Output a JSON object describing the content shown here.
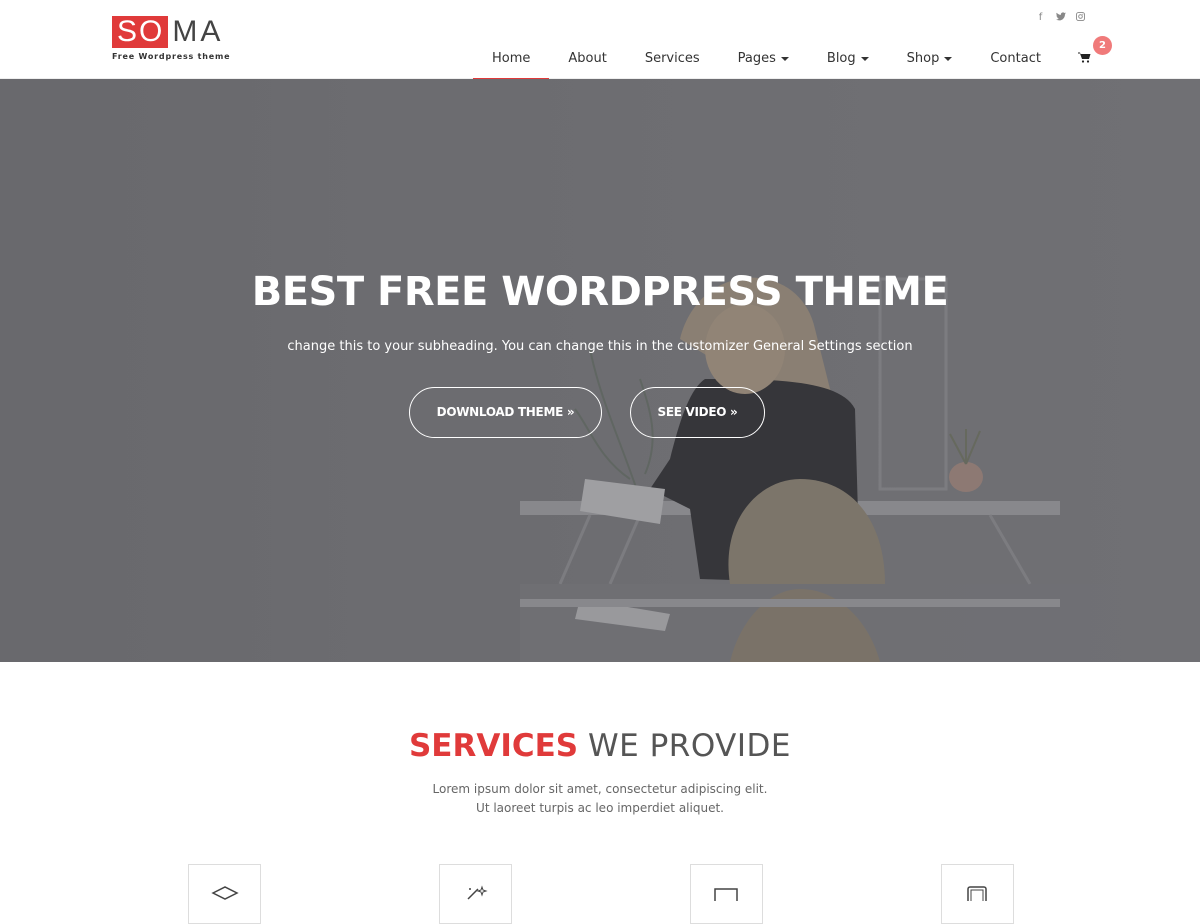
{
  "brand": {
    "logo_highlight": "SO",
    "logo_rest": "MA",
    "tagline": "Free Wordpress theme",
    "accent": "#e03a3a"
  },
  "social": [
    {
      "icon": "facebook-icon",
      "glyph": "f"
    },
    {
      "icon": "twitter-icon",
      "glyph": "🐦"
    },
    {
      "icon": "instagram-icon",
      "glyph": "◎"
    }
  ],
  "nav": {
    "items": [
      {
        "label": "Home",
        "active": true
      },
      {
        "label": "About"
      },
      {
        "label": "Services"
      },
      {
        "label": "Pages",
        "dropdown": true
      },
      {
        "label": "Blog",
        "dropdown": true
      },
      {
        "label": "Shop",
        "dropdown": true
      },
      {
        "label": "Contact"
      }
    ],
    "cart_count": "2"
  },
  "hero": {
    "title": "BEST FREE WORDPRESS THEME",
    "subtitle": "change this to your subheading. You can change this in the customizer General Settings section",
    "download_label": "DOWNLOAD THEME »",
    "video_label": "SEE VIDEO »"
  },
  "services": {
    "title_highlight": "SERVICES",
    "title_rest": "WE PROVIDE",
    "description": "Lorem ipsum dolor sit amet, consectetur adipiscing elit. Ut laoreet turpis ac leo imperdiet aliquet.",
    "boxes": [
      {
        "icon": "layers-icon"
      },
      {
        "icon": "magic-icon"
      },
      {
        "icon": "monitor-icon"
      },
      {
        "icon": "tablet-icon"
      }
    ]
  }
}
